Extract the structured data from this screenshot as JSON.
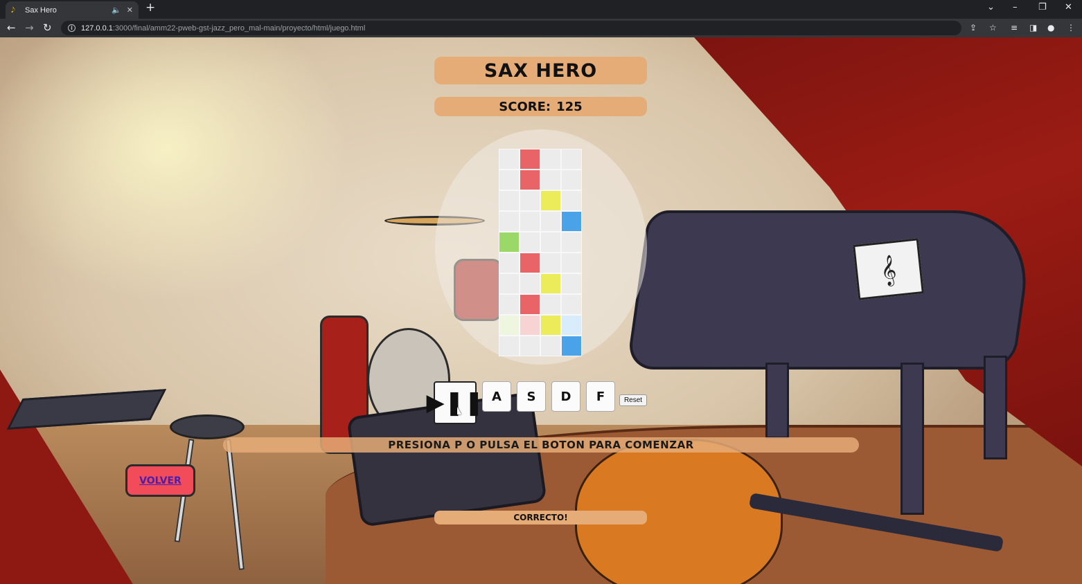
{
  "browser": {
    "tab_title": "Sax Hero",
    "tab_favicon": "saxophone-icon",
    "url_host": "127.0.0.1",
    "url_rest": ":3000/final/amm22-pweb-gst-jazz_pero_mal-main/proyecto/html/juego.html"
  },
  "game": {
    "title": "SAX HERO",
    "score_label": "SCORE:",
    "score_value": "125",
    "play_pause_symbol": "▶❚❚",
    "keys": [
      "A",
      "S",
      "D",
      "F"
    ],
    "reset_label": "Reset",
    "instruction": "PRESIONA P O PULSA EL BOTON PARA COMENZAR",
    "feedback": "CORRECTO!",
    "back_label": "VOLVER"
  },
  "board": {
    "columns": 4,
    "rows": [
      [
        null,
        "red",
        null,
        null
      ],
      [
        null,
        "red",
        null,
        null
      ],
      [
        null,
        null,
        "yellow",
        null
      ],
      [
        null,
        null,
        null,
        "blue"
      ],
      [
        "green",
        null,
        null,
        null
      ],
      [
        null,
        "red",
        null,
        null
      ],
      [
        null,
        null,
        "yellow",
        null
      ],
      [
        null,
        "red",
        null,
        null
      ],
      [
        "green-faded",
        "red-faded",
        "yellow",
        "blue-faded"
      ],
      [
        null,
        null,
        null,
        "blue"
      ]
    ]
  },
  "colors": {
    "red": "#e86466",
    "yellow": "#ecec5a",
    "blue": "#4aa3e8",
    "green": "#9ad968",
    "red-faded": "#f7d3d4",
    "green-faded": "#eff6df",
    "blue-faded": "#d8ecfb",
    "panel": "#e5ac77",
    "volver_bg": "#f24b5a"
  }
}
